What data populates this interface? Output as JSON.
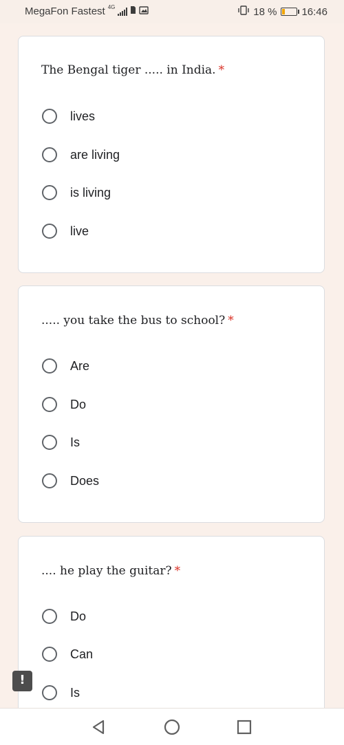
{
  "status_bar": {
    "carrier": "MegaFon Fastest",
    "network_badge": "4G",
    "battery_percent": "18 %",
    "time": "16:46",
    "battery_level": 0.18,
    "icons": [
      "signal-icon",
      "sim-icon",
      "gallery-icon",
      "vibrate-icon",
      "battery-icon"
    ]
  },
  "questions": [
    {
      "title": "The Bengal tiger ..... in India.",
      "required_mark": "*",
      "options": [
        "lives",
        "are living",
        "is living",
        "live"
      ]
    },
    {
      "title": "..... you take the bus to school?",
      "required_mark": "*",
      "options": [
        "Are",
        "Do",
        "Is",
        "Does"
      ]
    },
    {
      "title": ".... he play the guitar?",
      "required_mark": "*",
      "options": [
        "Do",
        "Can",
        "Is"
      ]
    }
  ],
  "feedback_button": {
    "label": "!"
  },
  "nav_bar": {
    "icons": [
      "back-icon",
      "home-icon",
      "recents-icon"
    ]
  },
  "colors": {
    "background": "#faf0ea",
    "card": "#ffffff",
    "required": "#d93025",
    "radio_border": "#5f6368",
    "battery_fill": "#f0a500"
  }
}
